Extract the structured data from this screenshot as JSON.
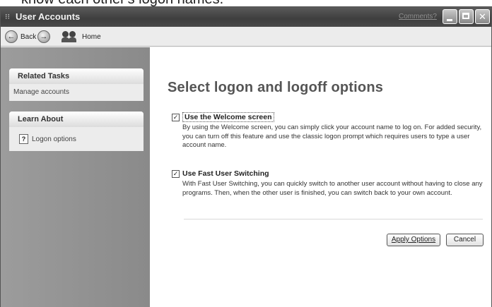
{
  "caption": "know each other's logon names.",
  "window": {
    "title": "User Accounts",
    "comments_link": "Comments?"
  },
  "toolbar": {
    "back_label": "Back",
    "home_label": "Home"
  },
  "sidebar": {
    "related_tasks": {
      "title": "Related Tasks",
      "items": [
        "Manage accounts"
      ]
    },
    "learn_about": {
      "title": "Learn About",
      "items": [
        "Logon options"
      ]
    }
  },
  "main": {
    "heading": "Select logon and logoff options",
    "options": [
      {
        "label": "Use the Welcome screen",
        "checked": true,
        "description": "By using the Welcome screen, you can simply click your account name to log on. For added security, you can turn off this feature and use the classic logon prompt which requires users to type a user account name."
      },
      {
        "label": "Use Fast User Switching",
        "checked": true,
        "description": "With Fast User Switching, you can quickly switch to another user account without having to close any programs. Then, when the other user is finished, you can switch back to your own account."
      }
    ],
    "apply_button": "Apply Options",
    "cancel_button": "Cancel"
  }
}
